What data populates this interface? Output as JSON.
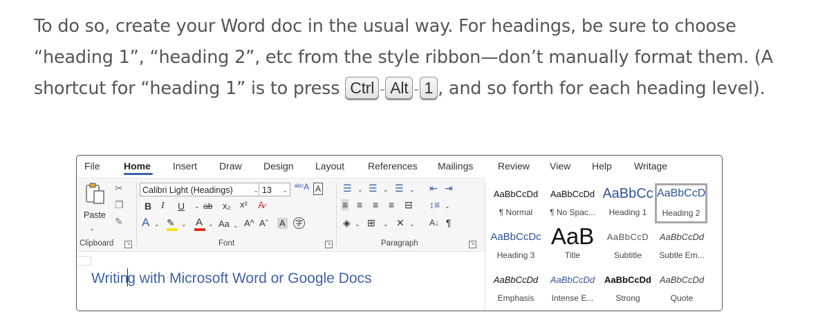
{
  "article": {
    "text1": "To do so, create your Word doc in the usual way. For headings, be sure to choose “heading 1”, “heading 2”, etc from the style ribbon—don’t manually format them. (A shortcut for “heading 1” is to press ",
    "keys": [
      "Ctrl",
      "Alt",
      "1"
    ],
    "key_sep": "-",
    "text2": ", and so forth for each heading level)."
  },
  "word": {
    "tabs": [
      "File",
      "Home",
      "Insert",
      "Draw",
      "Design",
      "Layout",
      "References",
      "Mailings",
      "Review",
      "View",
      "Help",
      "Writage"
    ],
    "active_tab": "Home",
    "clipboard": {
      "paste_label": "Paste",
      "group_label": "Clipboard"
    },
    "font": {
      "name": "Calibri Light (Headings)",
      "size": "13",
      "group_label": "Font",
      "change_case": "Aa",
      "grow": "A^",
      "shrink": "Aˇ"
    },
    "paragraph": {
      "group_label": "Paragraph"
    },
    "styles": [
      {
        "preview": "AaBbCcDd",
        "name": "¶ Normal",
        "color": "#111111"
      },
      {
        "preview": "AaBbCcDd",
        "name": "¶ No Spac...",
        "color": "#111111"
      },
      {
        "preview": "AaBbCc",
        "name": "Heading 1",
        "color": "#2f5597"
      },
      {
        "preview": "AaBbCcD",
        "name": "Heading 2",
        "color": "#2f5597"
      },
      {
        "preview": "AaBbCcDc",
        "name": "Heading 3",
        "color": "#2f5597"
      },
      {
        "preview": "AaB",
        "name": "Title",
        "color": "#111111"
      },
      {
        "preview": "AaBbCcD",
        "name": "Subtitle",
        "color": "#595959"
      },
      {
        "preview": "AaBbCcDd",
        "name": "Subtle Em...",
        "color": "#404040"
      },
      {
        "preview": "AaBbCcDd",
        "name": "Emphasis",
        "color": "#111111"
      },
      {
        "preview": "AaBbCcDd",
        "name": "Intense E...",
        "color": "#2f5597"
      },
      {
        "preview": "AaBbCcDd",
        "name": "Strong",
        "color": "#111111"
      },
      {
        "preview": "AaBbCcDd",
        "name": "Quote",
        "color": "#404040"
      }
    ],
    "document": {
      "heading_before_caret": "Writin",
      "heading_after_caret": "g with Microsoft Word or Google Docs"
    }
  },
  "colors": {
    "accent": "#3b5fa8",
    "heading": "#3f62a6",
    "body_text": "#555555"
  }
}
